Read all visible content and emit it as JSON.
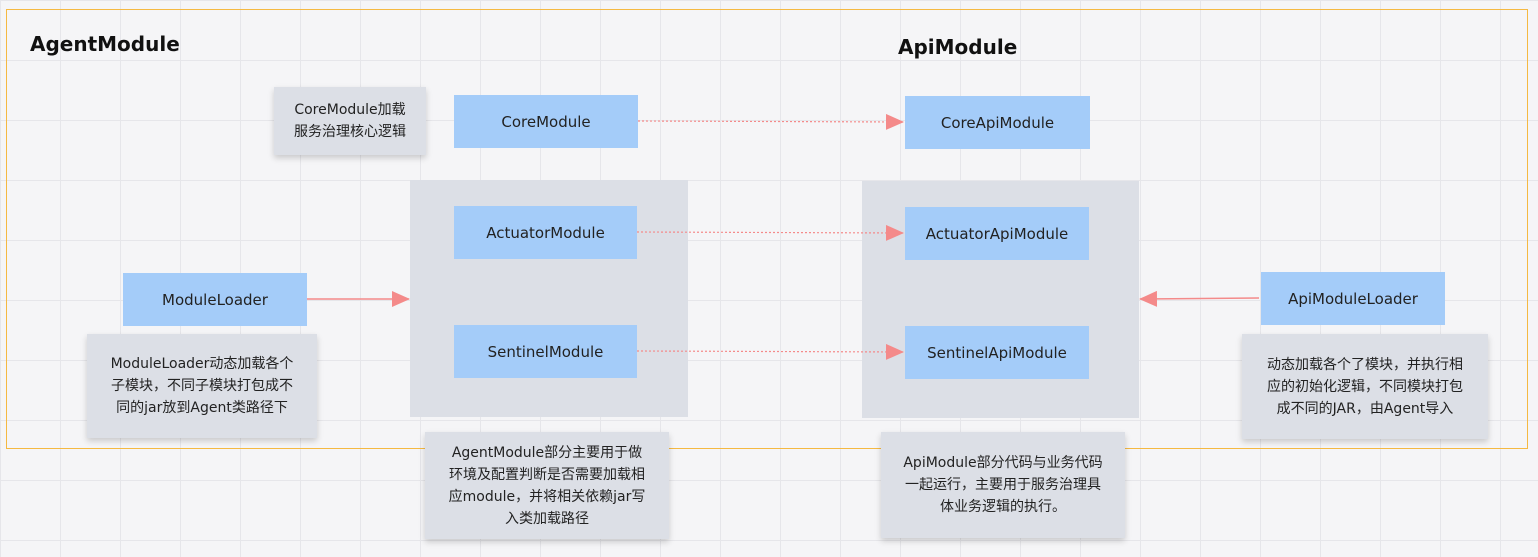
{
  "titles": {
    "agent": "AgentModule",
    "api": "ApiModule"
  },
  "agent_modules": {
    "core": "CoreModule",
    "actuator": "ActuatorModule",
    "sentinel": "SentinelModule",
    "loader": "ModuleLoader"
  },
  "api_modules": {
    "core": "CoreApiModule",
    "actuator": "ActuatorApiModule",
    "sentinel": "SentinelApiModule",
    "loader": "ApiModuleLoader"
  },
  "notes": {
    "core": [
      "CoreModule加载",
      "服务治理核心逻辑"
    ],
    "loader": [
      "ModuleLoader动态加载各个",
      "子模块，不同子模块打包成不",
      "同的jar放到Agent类路径下"
    ],
    "agent": [
      "AgentModule部分主要用于做",
      "环境及配置判断是否需要加载相",
      "应module，并将相关依赖jar写",
      "入类加载路径"
    ],
    "api": [
      "ApiModule部分代码与业务代码",
      "一起运行，主要用于服务治理具",
      "体业务逻辑的执行。"
    ],
    "api_loader": [
      "动态加载各个了模块，并执行相",
      "应的初始化逻辑，不同模块打包",
      "成不同的JAR，由Agent导入"
    ]
  },
  "colors": {
    "frame": "#f5b942",
    "module_box": "#a4ccf9",
    "group_bg": "#dcdfe6",
    "arrow": "#f48a8a"
  }
}
